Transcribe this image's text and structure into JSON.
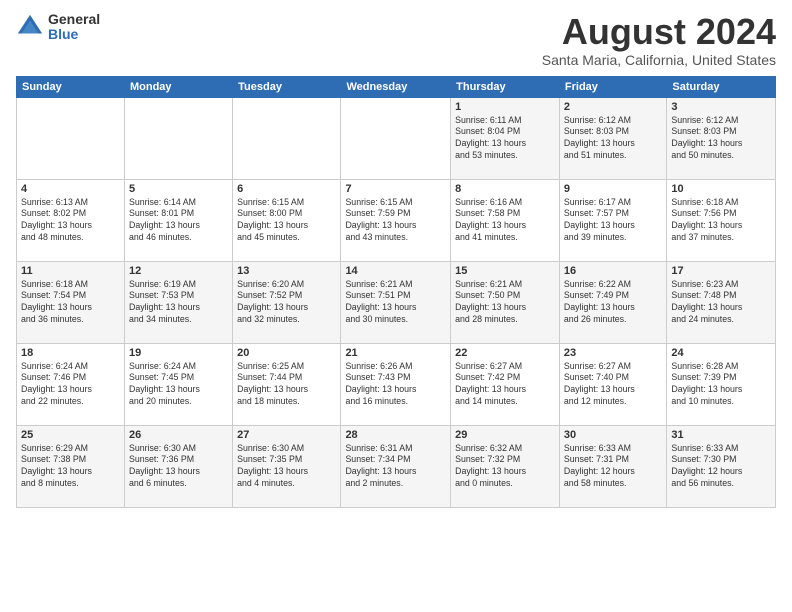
{
  "logo": {
    "general": "General",
    "blue": "Blue"
  },
  "title": {
    "main": "August 2024",
    "sub": "Santa Maria, California, United States"
  },
  "calendar": {
    "headers": [
      "Sunday",
      "Monday",
      "Tuesday",
      "Wednesday",
      "Thursday",
      "Friday",
      "Saturday"
    ],
    "rows": [
      [
        {
          "day": "",
          "info": ""
        },
        {
          "day": "",
          "info": ""
        },
        {
          "day": "",
          "info": ""
        },
        {
          "day": "",
          "info": ""
        },
        {
          "day": "1",
          "info": "Sunrise: 6:11 AM\nSunset: 8:04 PM\nDaylight: 13 hours\nand 53 minutes."
        },
        {
          "day": "2",
          "info": "Sunrise: 6:12 AM\nSunset: 8:03 PM\nDaylight: 13 hours\nand 51 minutes."
        },
        {
          "day": "3",
          "info": "Sunrise: 6:12 AM\nSunset: 8:03 PM\nDaylight: 13 hours\nand 50 minutes."
        }
      ],
      [
        {
          "day": "4",
          "info": "Sunrise: 6:13 AM\nSunset: 8:02 PM\nDaylight: 13 hours\nand 48 minutes."
        },
        {
          "day": "5",
          "info": "Sunrise: 6:14 AM\nSunset: 8:01 PM\nDaylight: 13 hours\nand 46 minutes."
        },
        {
          "day": "6",
          "info": "Sunrise: 6:15 AM\nSunset: 8:00 PM\nDaylight: 13 hours\nand 45 minutes."
        },
        {
          "day": "7",
          "info": "Sunrise: 6:15 AM\nSunset: 7:59 PM\nDaylight: 13 hours\nand 43 minutes."
        },
        {
          "day": "8",
          "info": "Sunrise: 6:16 AM\nSunset: 7:58 PM\nDaylight: 13 hours\nand 41 minutes."
        },
        {
          "day": "9",
          "info": "Sunrise: 6:17 AM\nSunset: 7:57 PM\nDaylight: 13 hours\nand 39 minutes."
        },
        {
          "day": "10",
          "info": "Sunrise: 6:18 AM\nSunset: 7:56 PM\nDaylight: 13 hours\nand 37 minutes."
        }
      ],
      [
        {
          "day": "11",
          "info": "Sunrise: 6:18 AM\nSunset: 7:54 PM\nDaylight: 13 hours\nand 36 minutes."
        },
        {
          "day": "12",
          "info": "Sunrise: 6:19 AM\nSunset: 7:53 PM\nDaylight: 13 hours\nand 34 minutes."
        },
        {
          "day": "13",
          "info": "Sunrise: 6:20 AM\nSunset: 7:52 PM\nDaylight: 13 hours\nand 32 minutes."
        },
        {
          "day": "14",
          "info": "Sunrise: 6:21 AM\nSunset: 7:51 PM\nDaylight: 13 hours\nand 30 minutes."
        },
        {
          "day": "15",
          "info": "Sunrise: 6:21 AM\nSunset: 7:50 PM\nDaylight: 13 hours\nand 28 minutes."
        },
        {
          "day": "16",
          "info": "Sunrise: 6:22 AM\nSunset: 7:49 PM\nDaylight: 13 hours\nand 26 minutes."
        },
        {
          "day": "17",
          "info": "Sunrise: 6:23 AM\nSunset: 7:48 PM\nDaylight: 13 hours\nand 24 minutes."
        }
      ],
      [
        {
          "day": "18",
          "info": "Sunrise: 6:24 AM\nSunset: 7:46 PM\nDaylight: 13 hours\nand 22 minutes."
        },
        {
          "day": "19",
          "info": "Sunrise: 6:24 AM\nSunset: 7:45 PM\nDaylight: 13 hours\nand 20 minutes."
        },
        {
          "day": "20",
          "info": "Sunrise: 6:25 AM\nSunset: 7:44 PM\nDaylight: 13 hours\nand 18 minutes."
        },
        {
          "day": "21",
          "info": "Sunrise: 6:26 AM\nSunset: 7:43 PM\nDaylight: 13 hours\nand 16 minutes."
        },
        {
          "day": "22",
          "info": "Sunrise: 6:27 AM\nSunset: 7:42 PM\nDaylight: 13 hours\nand 14 minutes."
        },
        {
          "day": "23",
          "info": "Sunrise: 6:27 AM\nSunset: 7:40 PM\nDaylight: 13 hours\nand 12 minutes."
        },
        {
          "day": "24",
          "info": "Sunrise: 6:28 AM\nSunset: 7:39 PM\nDaylight: 13 hours\nand 10 minutes."
        }
      ],
      [
        {
          "day": "25",
          "info": "Sunrise: 6:29 AM\nSunset: 7:38 PM\nDaylight: 13 hours\nand 8 minutes."
        },
        {
          "day": "26",
          "info": "Sunrise: 6:30 AM\nSunset: 7:36 PM\nDaylight: 13 hours\nand 6 minutes."
        },
        {
          "day": "27",
          "info": "Sunrise: 6:30 AM\nSunset: 7:35 PM\nDaylight: 13 hours\nand 4 minutes."
        },
        {
          "day": "28",
          "info": "Sunrise: 6:31 AM\nSunset: 7:34 PM\nDaylight: 13 hours\nand 2 minutes."
        },
        {
          "day": "29",
          "info": "Sunrise: 6:32 AM\nSunset: 7:32 PM\nDaylight: 13 hours\nand 0 minutes."
        },
        {
          "day": "30",
          "info": "Sunrise: 6:33 AM\nSunset: 7:31 PM\nDaylight: 12 hours\nand 58 minutes."
        },
        {
          "day": "31",
          "info": "Sunrise: 6:33 AM\nSunset: 7:30 PM\nDaylight: 12 hours\nand 56 minutes."
        }
      ]
    ]
  }
}
